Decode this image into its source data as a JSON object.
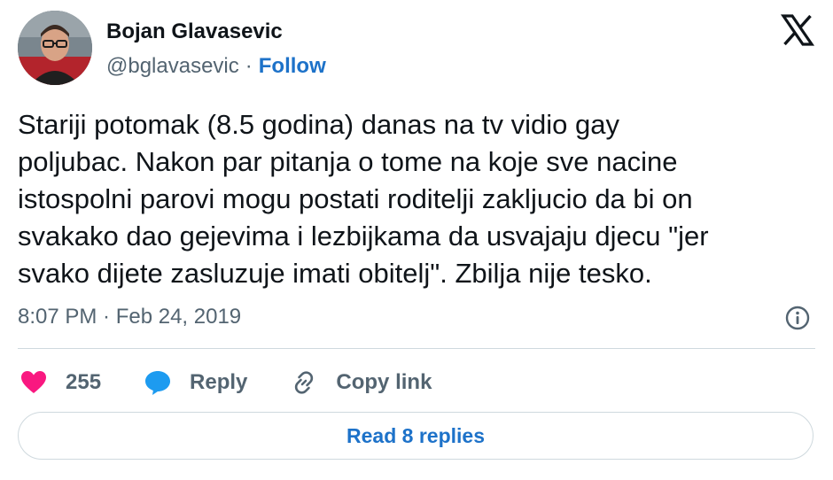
{
  "author": {
    "name": "Bojan Glavasevic",
    "handle": "@bglavasevic",
    "separator": "·",
    "follow_label": "Follow"
  },
  "brand_icon": "x-logo-icon",
  "tweet": {
    "text": "Stariji potomak (8.5 godina) danas na tv vidio gay\npoljubac. Nakon par pitanja o tome na koje sve nacine\nistospolni parovi mogu postati roditelji zakljucio da bi on\nsvakako dao gejevima i lezbijkama da usvajaju djecu \"jer\nsvako dijete zasluzuje imati obitelj\". Zbilja nije tesko.",
    "timestamp": "8:07 PM · Feb 24, 2019"
  },
  "actions": {
    "like_icon": "heart-icon",
    "like_count": "255",
    "reply_icon": "speech-bubble-icon",
    "reply_label": "Reply",
    "copy_icon": "link-icon",
    "copy_label": "Copy link"
  },
  "read_replies_label": "Read 8 replies",
  "colors": {
    "link": "#1d72c9",
    "heart": "#f91880",
    "reply_bubble": "#1d9bf0",
    "muted": "#536471",
    "text": "#0f1419",
    "divider": "#cfd9de"
  }
}
